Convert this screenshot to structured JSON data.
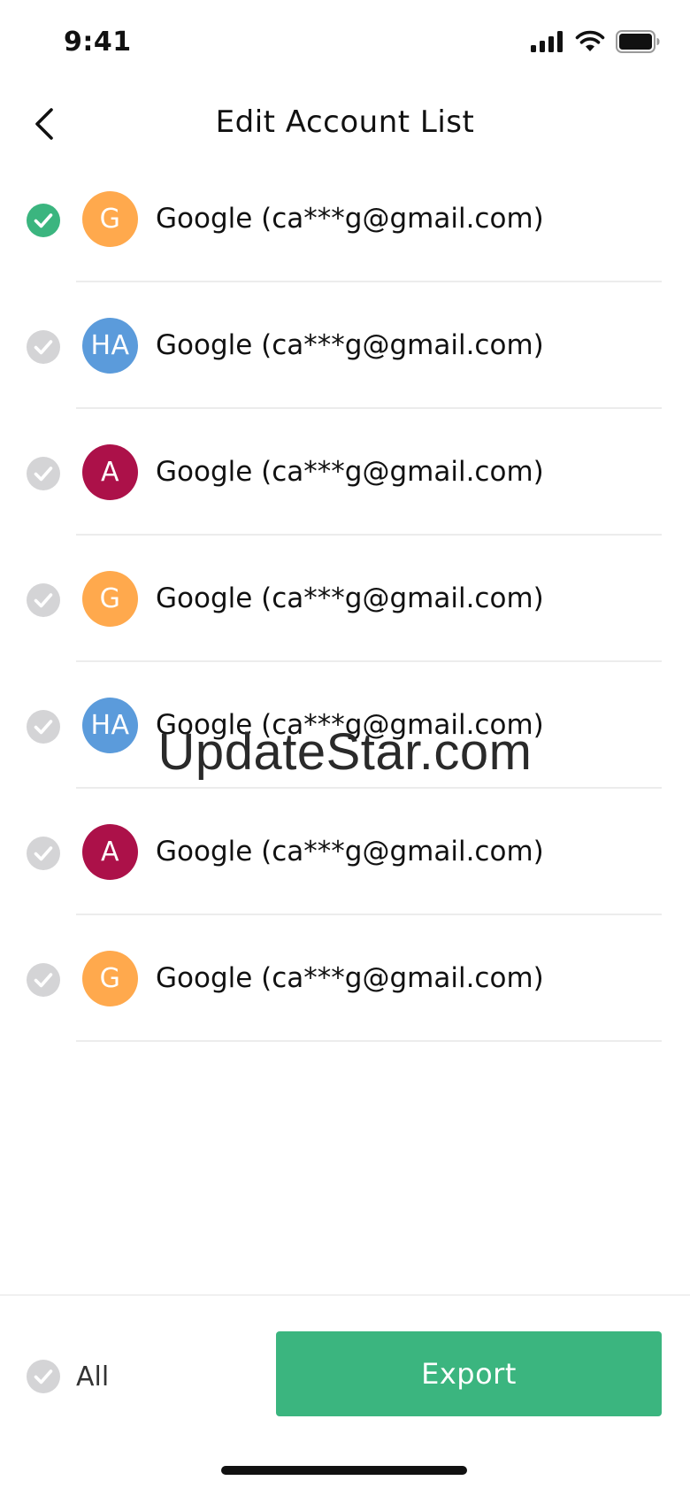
{
  "status_bar": {
    "time": "9:41",
    "icons": [
      "signal-icon",
      "wifi-icon",
      "battery-icon"
    ]
  },
  "header": {
    "title": "Edit Account List",
    "back_icon": "chevron-left-icon"
  },
  "colors": {
    "accent_green": "#3bb57f",
    "unchecked_gray": "#d4d4d6",
    "avatar_orange": "#ffa94d",
    "avatar_blue": "#5b9bdb",
    "avatar_crimson": "#ac1149"
  },
  "accounts": [
    {
      "initials": "G",
      "avatar_color": "#ffa94d",
      "label": "Google (ca***g@gmail.com)",
      "selected": true
    },
    {
      "initials": "HA",
      "avatar_color": "#5b9bdb",
      "label": "Google (ca***g@gmail.com)",
      "selected": false
    },
    {
      "initials": "A",
      "avatar_color": "#ac1149",
      "label": "Google (ca***g@gmail.com)",
      "selected": false
    },
    {
      "initials": "G",
      "avatar_color": "#ffa94d",
      "label": "Google (ca***g@gmail.com)",
      "selected": false
    },
    {
      "initials": "HA",
      "avatar_color": "#5b9bdb",
      "label": "Google (ca***g@gmail.com)",
      "selected": false
    },
    {
      "initials": "A",
      "avatar_color": "#ac1149",
      "label": "Google (ca***g@gmail.com)",
      "selected": false
    },
    {
      "initials": "G",
      "avatar_color": "#ffa94d",
      "label": "Google (ca***g@gmail.com)",
      "selected": false
    }
  ],
  "watermark": "UpdateStar.com",
  "footer": {
    "select_all_label": "All",
    "select_all_checked": false,
    "export_label": "Export"
  }
}
